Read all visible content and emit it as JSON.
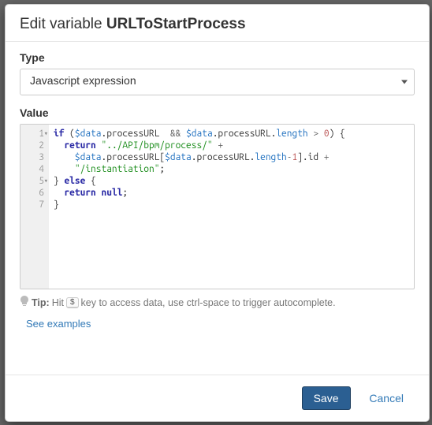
{
  "header": {
    "prefix": "Edit variable ",
    "name": "URLToStartProcess"
  },
  "type": {
    "label": "Type",
    "selected": "Javascript expression"
  },
  "value": {
    "label": "Value",
    "lines": [
      {
        "n": 1,
        "fold": true,
        "raw": "if ($data.processURL  && $data.processURL.length > 0) {"
      },
      {
        "n": 2,
        "fold": false,
        "raw": "  return \"../API/bpm/process/\" +"
      },
      {
        "n": 3,
        "fold": false,
        "raw": "    $data.processURL[$data.processURL.length-1].id +"
      },
      {
        "n": 4,
        "fold": false,
        "raw": "    \"/instantiation\";"
      },
      {
        "n": 5,
        "fold": true,
        "raw": "} else {"
      },
      {
        "n": 6,
        "fold": false,
        "raw": "  return null;"
      },
      {
        "n": 7,
        "fold": false,
        "raw": "}"
      }
    ]
  },
  "tip": {
    "label": "Tip:",
    "pre": "Hit",
    "key": "$",
    "post": "key to access data, use ctrl-space to trigger autocomplete."
  },
  "links": {
    "examples": "See examples"
  },
  "footer": {
    "save": "Save",
    "cancel": "Cancel"
  }
}
